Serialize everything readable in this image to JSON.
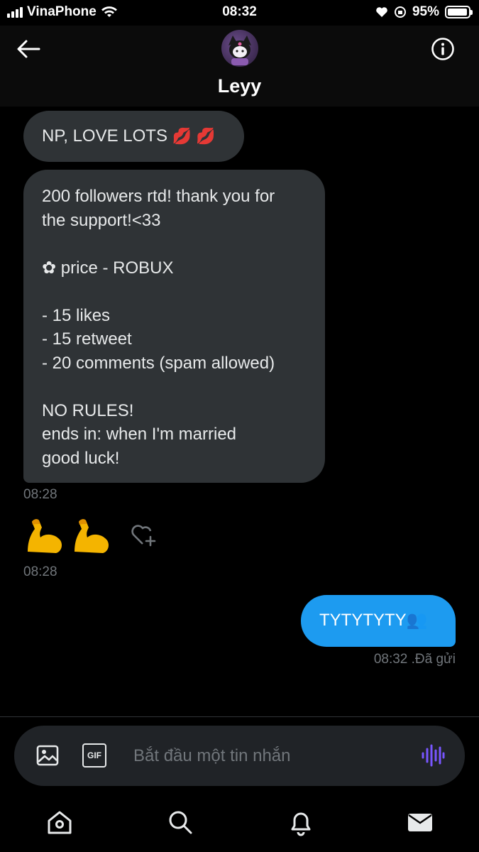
{
  "status_bar": {
    "carrier": "VinaPhone",
    "time": "08:32",
    "battery": "95%",
    "battery_level": 0.95
  },
  "header": {
    "contact_name": "Leyy"
  },
  "messages": {
    "msg1": "NP, LOVE LOTS",
    "msg1_emoji": "💋 💋",
    "msg2_lines": [
      "200 followers rtd! thank you for",
      "the support!<33",
      "",
      "✿ price - ROBUX",
      "",
      "- 15 likes",
      "- 15 retweet",
      "- 20 comments (spam allowed)",
      "",
      "NO RULES!",
      "ends in: when I'm married",
      "good luck!"
    ],
    "time1": "08:28",
    "time2": "08:28",
    "outgoing_text": "TYTYTYTY",
    "outgoing_emoji": "👥",
    "outgoing_status": "08:32 .Đã gửi"
  },
  "composer": {
    "placeholder": "Bắt đầu một tin nhắn",
    "gif_label": "GIF"
  },
  "colors": {
    "accent": "#1d9bf0",
    "incoming_bubble": "#2f3336",
    "voice_accent": "#7856ff"
  },
  "icons": [
    "back-arrow-icon",
    "info-icon",
    "image-icon",
    "gif-icon",
    "voice-waveform-icon",
    "home-icon",
    "search-icon",
    "bell-icon",
    "mail-icon",
    "heart-plus-icon",
    "flexed-biceps-icon"
  ]
}
